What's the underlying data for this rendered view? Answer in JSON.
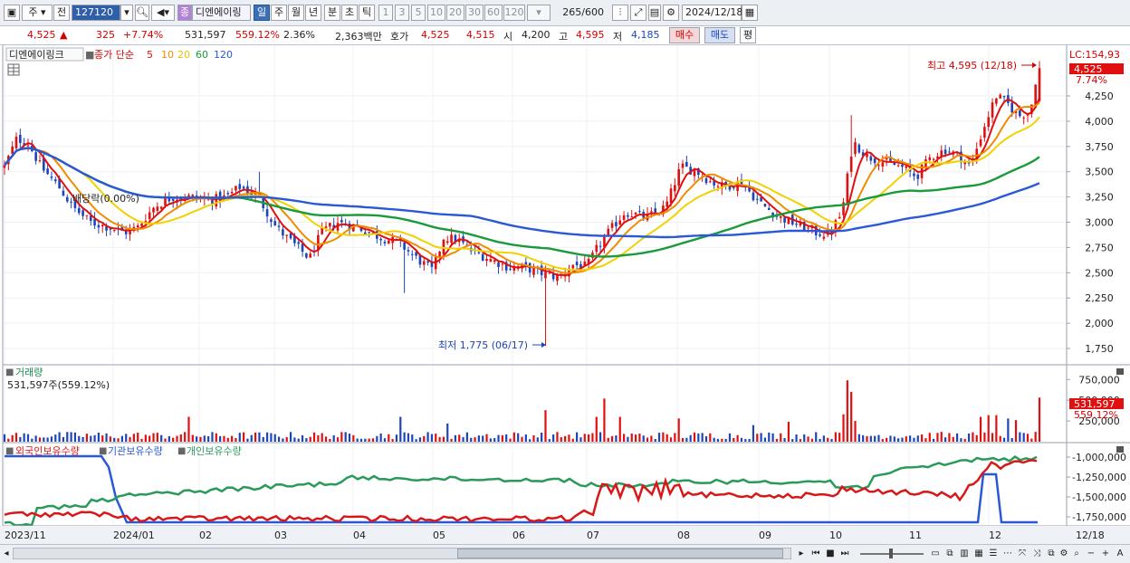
{
  "toolbar": {
    "period_select": "주",
    "prev_label": "전",
    "stock_code": "127120",
    "stock_name": "디엔에이링",
    "type_badge": "종",
    "periods": [
      "일",
      "주",
      "월",
      "년",
      "분",
      "초",
      "틱"
    ],
    "selected_period": "일",
    "counts": [
      "1",
      "3",
      "5",
      "10",
      "20",
      "30",
      "60",
      "120"
    ],
    "data_count": "265",
    "data_total": "/600",
    "date": "2024/12/18"
  },
  "quote": {
    "price": "4,525",
    "change_arrow": "▲",
    "change": "325",
    "change_pct": "+7.74%",
    "volume": "531,597",
    "volume_ratio": "559.12%",
    "turnover": "2.36%",
    "amount": "2,363백만",
    "bid_label": "호가",
    "ask": "4,525",
    "bid": "4,515",
    "open_label": "시",
    "open": "4,200",
    "high_label": "고",
    "high": "4,595",
    "low_label": "저",
    "low": "4,185",
    "buy_button": "매수",
    "sell_button": "매도",
    "eval_button": "평"
  },
  "price_panel": {
    "name_tag": "디엔에이링크",
    "ma_label": "종가 단순",
    "ma_periods": [
      "5",
      "10",
      "20",
      "60",
      "120"
    ],
    "ma_colors": [
      "#e01010",
      "#f08c00",
      "#f2d100",
      "#1a9a3a",
      "#2b58d6"
    ],
    "event_label": "배당락(0.00%)",
    "high_note": "최고 4,595 (12/18)",
    "low_note": "최저 1,775 (06/17)",
    "lc_label": "LC:154,93",
    "last_price_tag": "4,525",
    "last_pct_tag": "7.74%",
    "y_ticks": [
      "4,250",
      "4,000",
      "3,750",
      "3,500",
      "3,250",
      "3,000",
      "2,750",
      "2,500",
      "2,250",
      "2,000",
      "1,750"
    ]
  },
  "volume_panel": {
    "title": "거래량",
    "subtitle": "531,597주(559.12%)",
    "y_ticks": [
      "750,000",
      "500,000",
      "250,000"
    ],
    "last_tag": "531,597",
    "last_pct": "559.12%"
  },
  "holdings_panel": {
    "series": [
      "외국인보유수량",
      "기관보유수량",
      "개인보유수량"
    ],
    "series_colors": [
      "#d81818",
      "#2b58d6",
      "#2a9a5a"
    ],
    "y_ticks": [
      "-1,000,000",
      "-1,250,000",
      "-1,500,000",
      "-1,750,000"
    ]
  },
  "x_axis": {
    "labels": [
      "2023/11",
      "2024/01",
      "02",
      "03",
      "04",
      "05",
      "06",
      "07",
      "08",
      "09",
      "10",
      "11",
      "12"
    ],
    "end_label": "12/18"
  }
}
